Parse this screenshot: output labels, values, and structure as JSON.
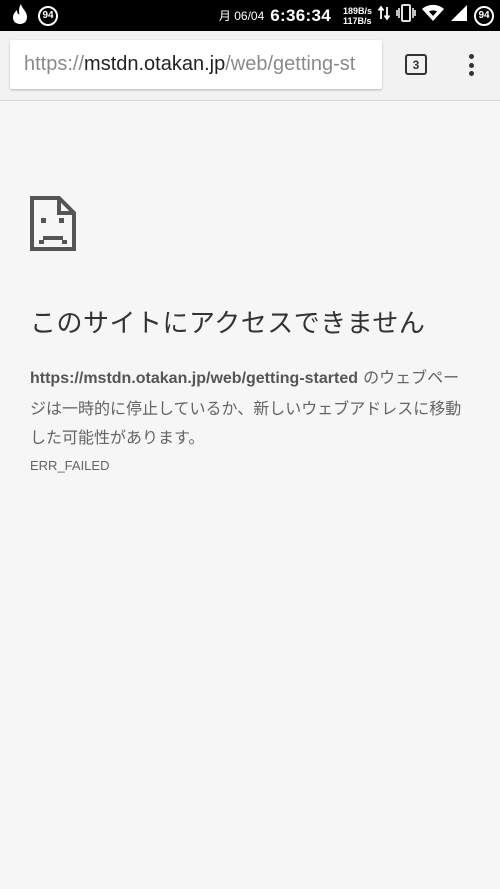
{
  "status_bar": {
    "notification_badge": "94",
    "date": "月 06/04",
    "time": "6:36:34",
    "upload_speed": "189B/s",
    "download_speed": "117B/s",
    "battery": "94",
    "icons": [
      "flame-notification-icon",
      "data-transfer-icon",
      "vibrate-icon",
      "wifi-icon",
      "cell-signal-icon",
      "battery-icon"
    ]
  },
  "toolbar": {
    "url_scheme": "https://",
    "url_host": "mstdn.otakan.jp",
    "url_path": "/web/getting-st",
    "tab_count": "3",
    "menu_icon": "overflow-menu-icon"
  },
  "error_page": {
    "icon": "sad-document-icon",
    "title": "このサイトにアクセスできません",
    "url_bold": "https://mstdn.otakan.jp/web/getting-started",
    "message": " のウェブページは一時的に停止しているか、新しいウェブアドレスに移動した可能性があります。",
    "error_code": "ERR_FAILED"
  },
  "colors": {
    "status_bar_bg": "#000000",
    "toolbar_bg": "#f2f2f2",
    "page_bg": "#f6f6f6",
    "title_text": "#333333",
    "body_text": "#646464"
  }
}
